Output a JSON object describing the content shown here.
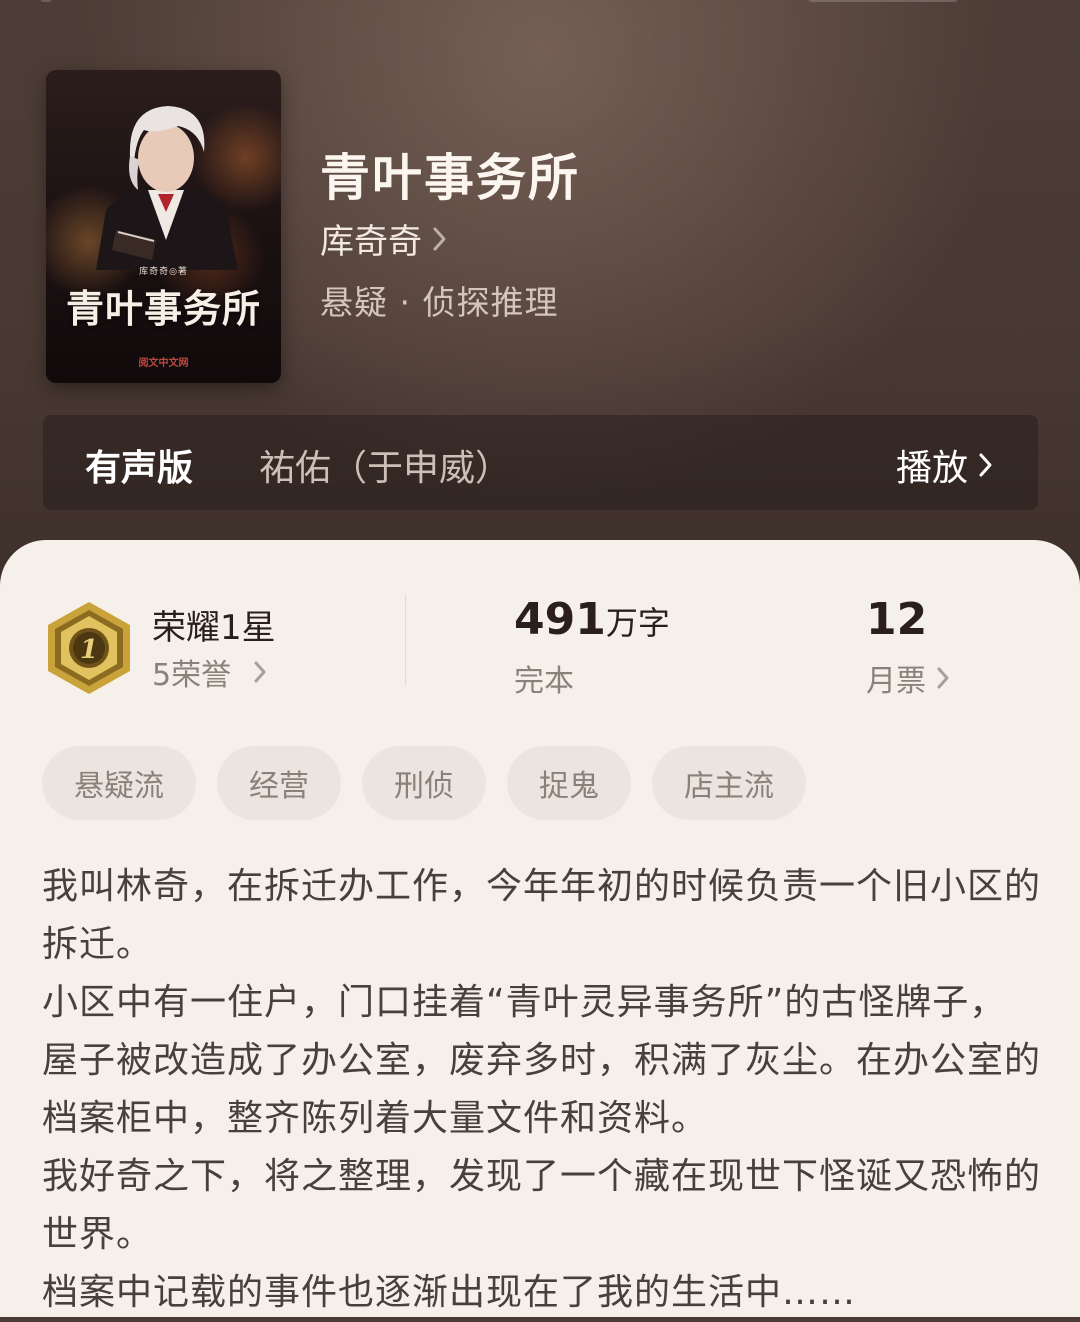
{
  "book": {
    "title": "青叶事务所",
    "author": "库奇奇",
    "genre": "悬疑 · 侦探推理",
    "cover": {
      "title": "青叶事务所",
      "author_tag": "库奇奇◎著",
      "publisher": "阅文中文网"
    }
  },
  "audio": {
    "label": "有声版",
    "narrator": "祐佑（于申威）",
    "play_label": "播放"
  },
  "stats": {
    "honor": {
      "title": "荣耀1星",
      "subtitle": "5荣誉",
      "medal_number": "1"
    },
    "words": {
      "number": "491",
      "unit": "万字",
      "status": "完本"
    },
    "monthly_tickets": {
      "value": "12",
      "label": "月票"
    }
  },
  "tags": [
    "悬疑流",
    "经营",
    "刑侦",
    "捉鬼",
    "店主流"
  ],
  "synopsis": [
    "我叫林奇，在拆迁办工作，今年年初的时候负责一个旧小区的拆迁。",
    "小区中有一住户，门口挂着“青叶灵异事务所”的古怪牌子，屋子被改造成了办公室，废弃多时，积满了灰尘。在办公室的档案柜中，整齐陈列着大量文件和资料。",
    "我好奇之下，将之整理，发现了一个藏在现世下怪诞又恐怖的世界。",
    "档案中记载的事件也逐渐出现在了我的生活中……"
  ],
  "colors": {
    "header_bg": "#4a3933",
    "panel_bg": "#f6f0ea",
    "tag_bg": "#ece5df",
    "medal_gold": "#c9a33a"
  }
}
